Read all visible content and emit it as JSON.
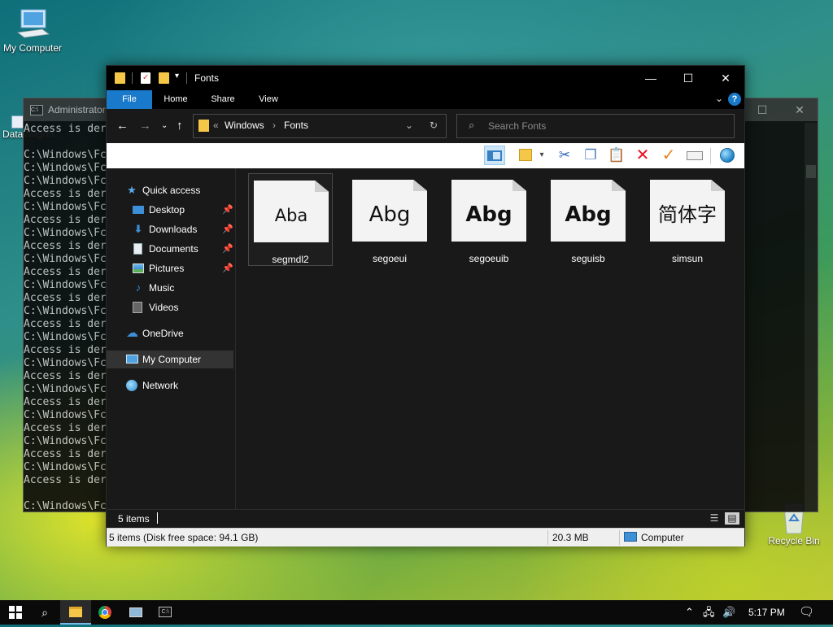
{
  "desktop": {
    "icons": [
      {
        "label": "My Computer"
      },
      {
        "label": "DataWagon..."
      },
      {
        "label": "Recycle Bin"
      }
    ]
  },
  "console": {
    "title": "Administrator",
    "lines": [
      "Access is der",
      "",
      "C:\\Windows\\Fc",
      "C:\\Windows\\Fc",
      "C:\\Windows\\Fc",
      "Access is der",
      "C:\\Windows\\Fc",
      "Access is der",
      "C:\\Windows\\Fc",
      "Access is der",
      "C:\\Windows\\Fc",
      "Access is der",
      "C:\\Windows\\Fc",
      "Access is der",
      "C:\\Windows\\Fc",
      "Access is der",
      "C:\\Windows\\Fc",
      "Access is der",
      "C:\\Windows\\Fc",
      "Access is der",
      "C:\\Windows\\Fc",
      "Access is der",
      "C:\\Windows\\Fc",
      "Access is der",
      "C:\\Windows\\Fc",
      "Access is der",
      "C:\\Windows\\Fc",
      "Access is der",
      "",
      "C:\\Windows\\Fc"
    ]
  },
  "explorer": {
    "title": "Fonts",
    "ribbon_tabs": [
      "File",
      "Home",
      "Share",
      "View"
    ],
    "address": {
      "chevrons": "«",
      "parts": [
        "Windows",
        "Fonts"
      ],
      "separator": "›"
    },
    "search_placeholder": "Search Fonts",
    "nav": {
      "quick_access": "Quick access",
      "items": [
        {
          "label": "Desktop",
          "pinned": true
        },
        {
          "label": "Downloads",
          "pinned": true
        },
        {
          "label": "Documents",
          "pinned": true
        },
        {
          "label": "Pictures",
          "pinned": true
        },
        {
          "label": "Music",
          "pinned": false
        },
        {
          "label": "Videos",
          "pinned": false
        }
      ],
      "onedrive": "OneDrive",
      "my_computer": "My Computer",
      "network": "Network"
    },
    "fonts": [
      {
        "name": "segmdl2",
        "sample": "Aba"
      },
      {
        "name": "segoeui",
        "sample": "Abg"
      },
      {
        "name": "segoeuib",
        "sample": "Abg"
      },
      {
        "name": "seguisb",
        "sample": "Abg"
      },
      {
        "name": "simsun",
        "sample": "简体字"
      }
    ],
    "item_count": "5 items",
    "statusbar": {
      "info": "5 items (Disk free space: 94.1 GB)",
      "size": "20.3 MB",
      "location": "Computer"
    }
  },
  "taskbar": {
    "time": "5:17 PM"
  },
  "colors": {
    "accent": "#1979ca",
    "folder": "#f5c748",
    "delete_red": "#e81123",
    "check_orange": "#e8841a"
  }
}
